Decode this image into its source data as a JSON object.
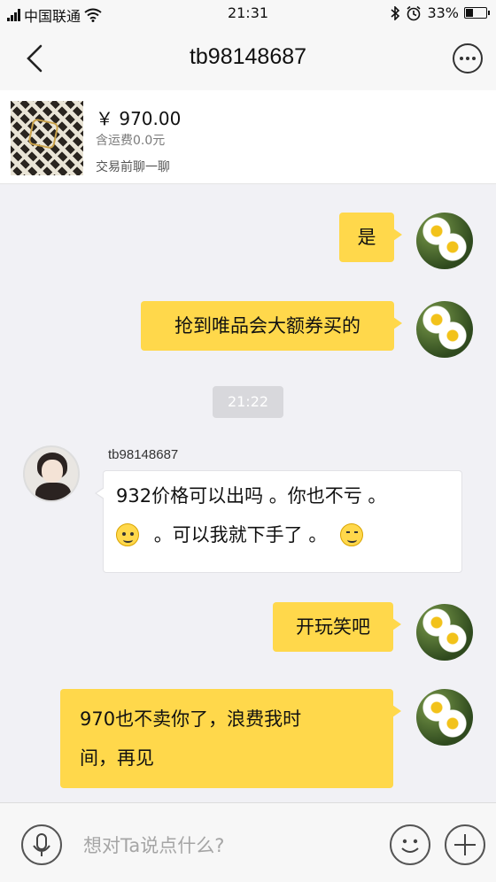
{
  "status_bar": {
    "carrier": "中国联通",
    "time": "21:31",
    "battery": "33%",
    "battery_level": 0.33,
    "icons": [
      "signal-icon",
      "wifi-icon",
      "bluetooth-icon",
      "alarm-icon",
      "battery-icon"
    ]
  },
  "header": {
    "title": "tb98148687",
    "back_icon": "chevron-left-icon",
    "more_icon": "more-icon"
  },
  "product": {
    "price": "￥ 970.00",
    "shipping": "含运费0.0元",
    "chat_prompt": "交易前聊一聊"
  },
  "messages": [
    {
      "from": "me",
      "text": "是"
    },
    {
      "from": "me",
      "text": "抢到唯品会大额券买的"
    },
    {
      "type": "timestamp",
      "text": "21:22"
    },
    {
      "from": "them",
      "sender": "tb98148687",
      "line1": "932价格可以出吗 。你也不亏 。",
      "line2": "。可以我就下手了 。",
      "emojis": [
        "smile-emoji-icon",
        "blush-emoji-icon"
      ]
    },
    {
      "from": "me",
      "text": "开玩笑吧"
    },
    {
      "from": "me",
      "line1": "970也不卖你了，浪费我时",
      "line2": "间，再见"
    }
  ],
  "input": {
    "placeholder": "想对Ta说点什么?",
    "voice_icon": "microphone-icon",
    "emoji_icon": "smiley-icon",
    "add_icon": "plus-icon"
  },
  "colors": {
    "my_bubble": "#ffd84b",
    "their_bubble": "#ffffff",
    "background": "#f1f1f5"
  }
}
